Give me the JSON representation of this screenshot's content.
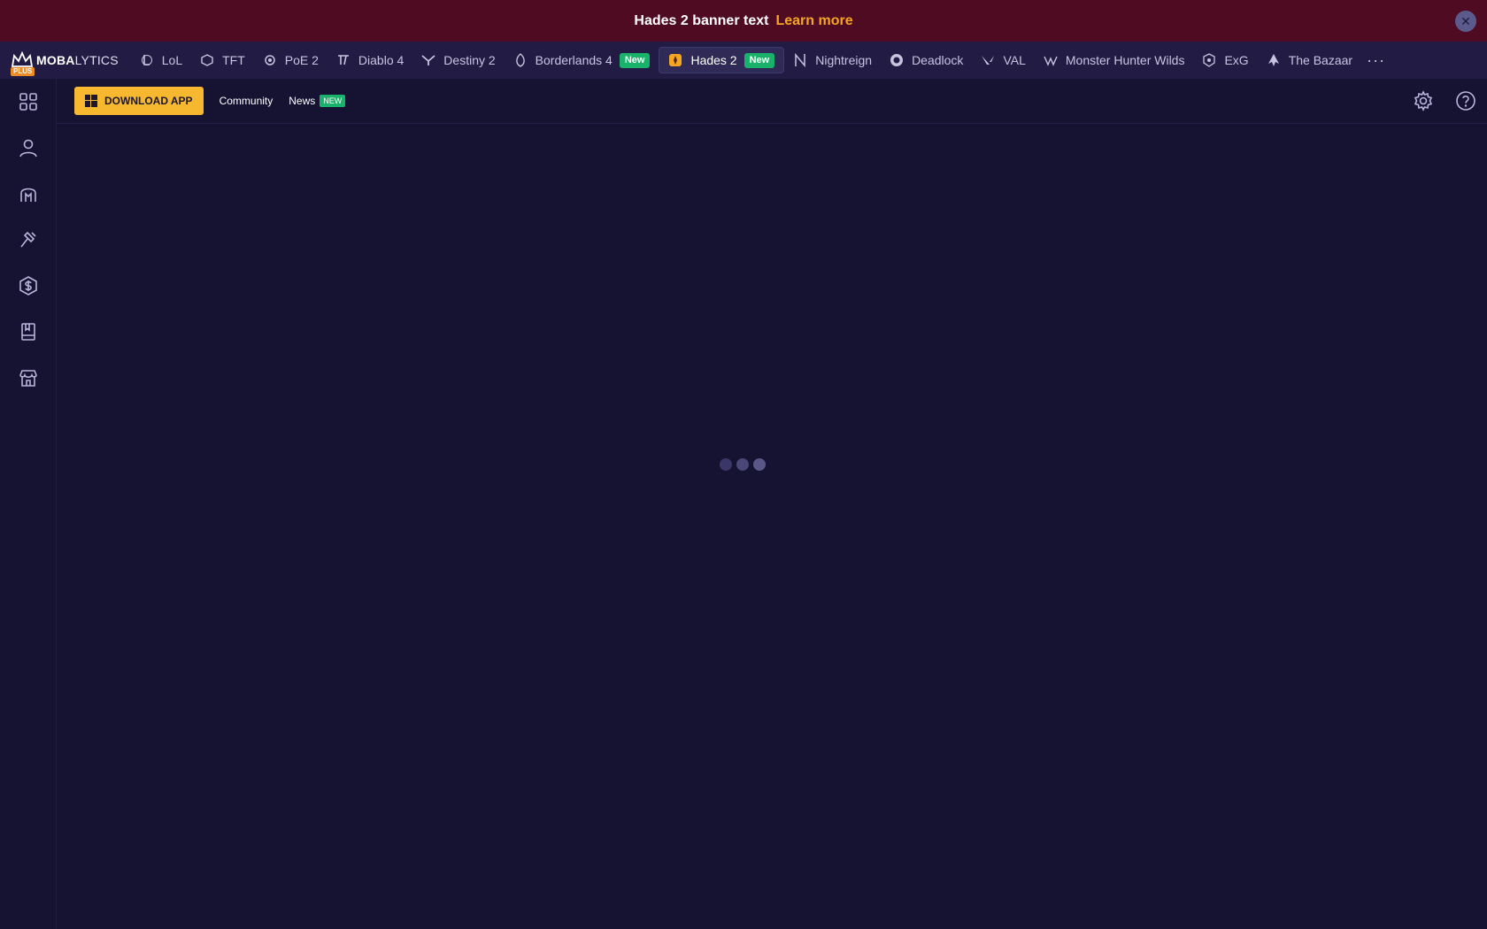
{
  "banner": {
    "text": "Hades 2 banner text",
    "link": "Learn more",
    "close_icon": "close-icon"
  },
  "logo": {
    "brand_bold": "MOBA",
    "brand_rest": "LYTICS",
    "plus": "PLUS"
  },
  "game_nav": {
    "items": [
      {
        "label": "LoL",
        "icon": "lol-icon"
      },
      {
        "label": "TFT",
        "icon": "tft-icon"
      },
      {
        "label": "PoE 2",
        "icon": "poe2-icon"
      },
      {
        "label": "Diablo 4",
        "icon": "diablo4-icon"
      },
      {
        "label": "Destiny 2",
        "icon": "destiny2-icon"
      },
      {
        "label": "Borderlands 4",
        "icon": "borderlands4-icon",
        "badge": "New"
      },
      {
        "label": "Hades 2",
        "icon": "hades2-icon",
        "badge": "New",
        "active": true
      },
      {
        "label": "Nightreign",
        "icon": "nightreign-icon"
      },
      {
        "label": "Deadlock",
        "icon": "deadlock-icon"
      },
      {
        "label": "VAL",
        "icon": "val-icon"
      },
      {
        "label": "Monster Hunter Wilds",
        "icon": "mhw-icon"
      },
      {
        "label": "ExG",
        "icon": "exg-icon"
      },
      {
        "label": "The Bazaar",
        "icon": "bazaar-icon"
      }
    ],
    "more": "···"
  },
  "sidebar": {
    "icons": [
      "dashboard-icon",
      "profile-icon",
      "helmet-icon",
      "hammer-icon",
      "coin-icon",
      "book-icon",
      "store-icon"
    ]
  },
  "subnav": {
    "download_label": "DOWNLOAD APP",
    "community_label": "Community",
    "news_label": "News",
    "news_badge": "NEW",
    "settings_icon": "gear-icon",
    "help_icon": "help-icon"
  },
  "colors": {
    "background": "#151232",
    "banner": "#4e0b21",
    "accent": "#f5b82e",
    "link": "#f5a623",
    "new_badge": "#18b26b"
  }
}
